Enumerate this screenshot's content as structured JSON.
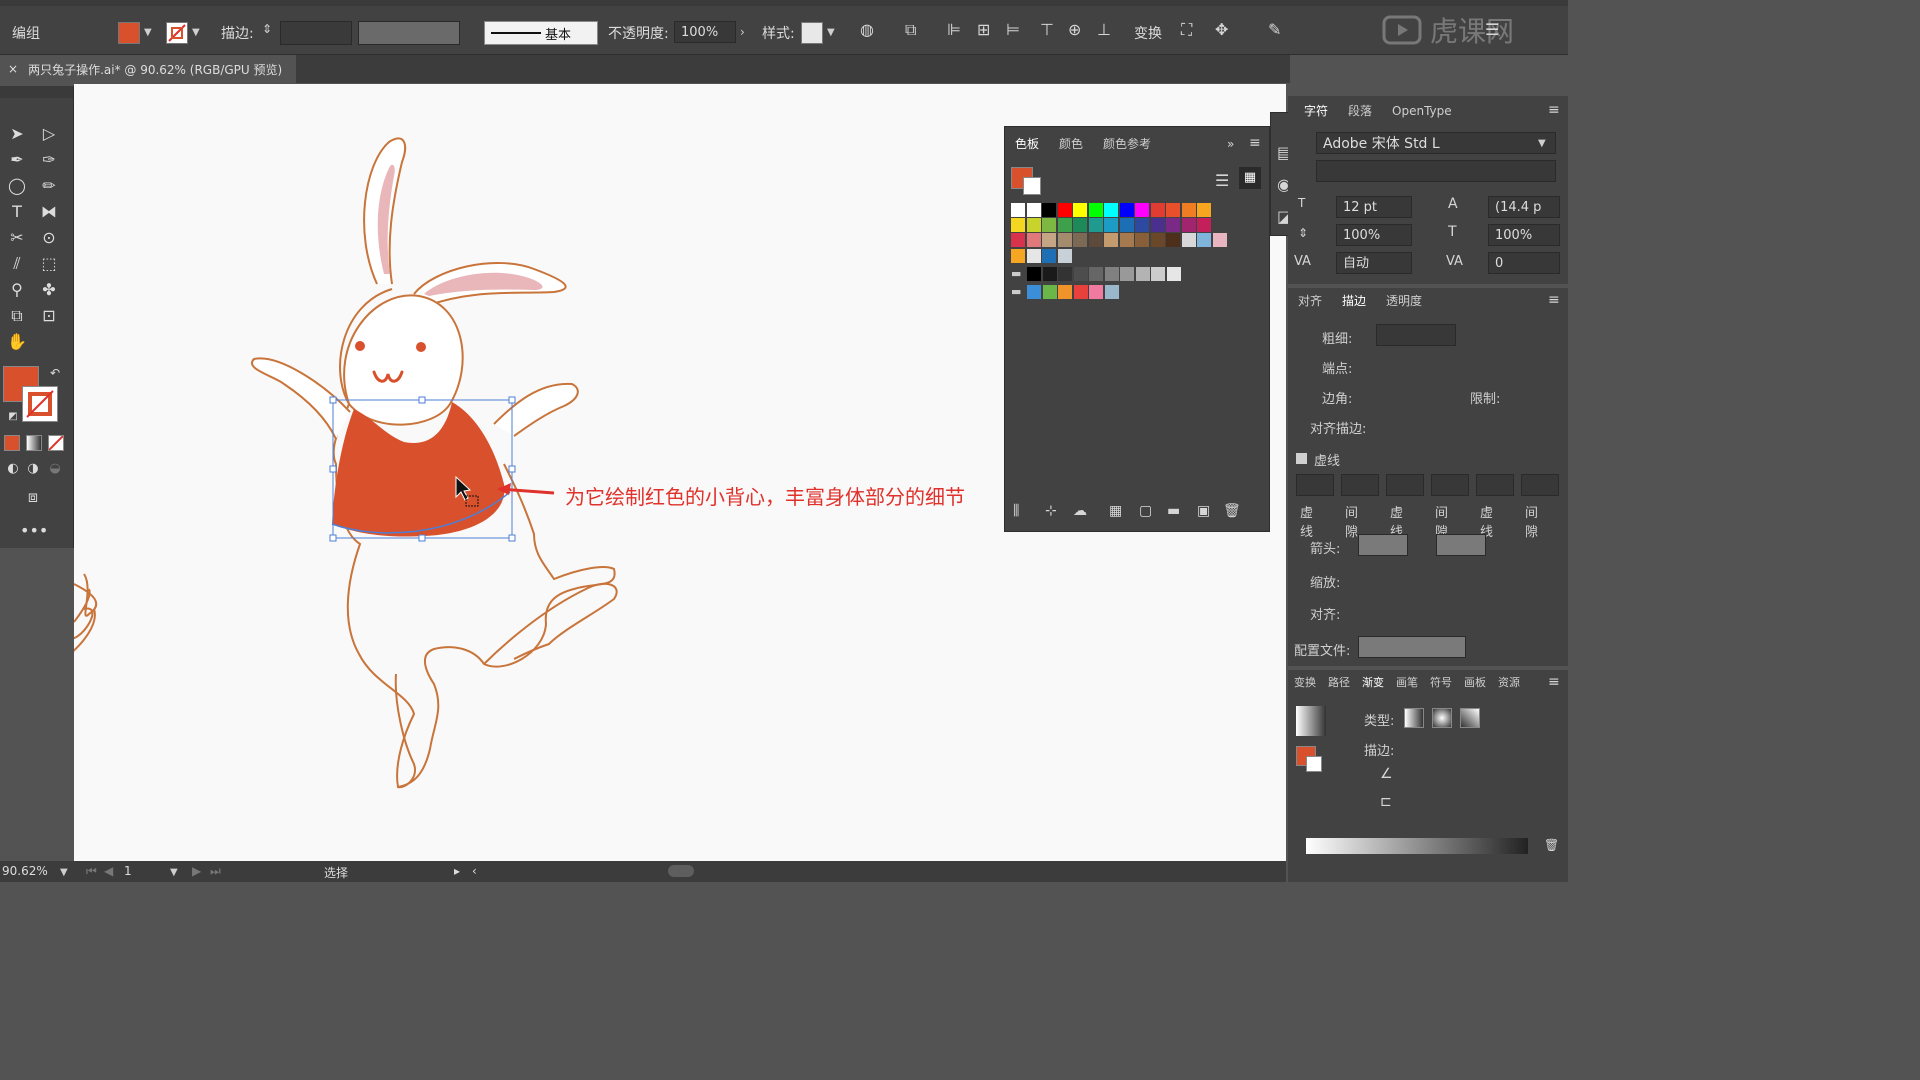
{
  "control_bar": {
    "group_label": "编组",
    "stroke_label": "描边:",
    "stroke_style_label": "基本",
    "opacity_label": "不透明度:",
    "opacity_value": "100%",
    "style_label": "样式:",
    "transform_label": "变换",
    "fill_color": "#d9512c"
  },
  "document_tab": {
    "close_glyph": "×",
    "title": "两只兔子操作.ai* @ 90.62% (RGB/GPU 预览)"
  },
  "canvas": {
    "annotation_text": "为它绘制红色的小背心，丰富身体部分的细节"
  },
  "swatches_panel": {
    "tabs": [
      "色板",
      "颜色",
      "颜色参考"
    ],
    "row1": [
      "#ffffff",
      "#ffffff",
      "#000000",
      "#ff0000",
      "#ffff00",
      "#00ff00",
      "#00ffff",
      "#0000ff",
      "#ff00ff",
      "#e03c31",
      "#e8502c",
      "#f07d22",
      "#f7a71f"
    ],
    "row2": [
      "#f5d722",
      "#c8d42c",
      "#7cb842",
      "#3ea04a",
      "#1e8a5a",
      "#1f9a8e",
      "#1c9bc4",
      "#1c6fb5",
      "#2d4aa0",
      "#4b2f8f",
      "#7a2a86",
      "#a1246f",
      "#c31f5a"
    ],
    "row3": [
      "#d8324d",
      "#e0787c",
      "#c4a584",
      "#a48b6e",
      "#7c6a55",
      "#5e4a3a",
      "#c39b6e",
      "#a47a4e",
      "#87603a",
      "#6b472a",
      "#4e2f1c",
      "#d8d8d8",
      "#7fb5dc",
      "#e8b4c0"
    ],
    "row4": [
      "#f5a623",
      "#e6e6e6",
      "#1f6fb5",
      "#c8d0d8"
    ],
    "gray_row": [
      "#000000",
      "#1a1a1a",
      "#333333",
      "#4d4d4d",
      "#666666",
      "#808080",
      "#999999",
      "#b3b3b3",
      "#cccccc",
      "#e6e6e6"
    ],
    "color_row": [
      "#3a8fd8",
      "#6ab648",
      "#f0932b",
      "#e8403a",
      "#f07aa0",
      "#9ab8cc"
    ]
  },
  "char_panel": {
    "tabs": [
      "字符",
      "段落",
      "OpenType"
    ],
    "font_name": "Adobe 宋体 Std L",
    "size": "12 pt",
    "leading": "(14.4 p",
    "v_scale": "100%",
    "h_scale": "100%",
    "kerning": "自动",
    "tracking": "0"
  },
  "stroke_panel": {
    "tabs": [
      "对齐",
      "描边",
      "透明度"
    ],
    "weight_label": "粗细:",
    "cap_label": "端点:",
    "corner_label": "边角:",
    "limit_label": "限制:",
    "align_label": "对齐描边:",
    "dashed_label": "虚线",
    "dash_labels": [
      "虚线",
      "间隙",
      "虚线",
      "间隙",
      "虚线",
      "间隙"
    ],
    "arrow_label": "箭头:",
    "scale_label": "缩放:",
    "align2_label": "对齐:",
    "profile_label": "配置文件:"
  },
  "gradient_panel": {
    "tabs": [
      "变换",
      "路径",
      "渐变",
      "画笔",
      "符号",
      "画板",
      "资源"
    ],
    "type_label": "类型:",
    "stroke_label": "描边:"
  },
  "status_bar": {
    "zoom": "90.62%",
    "page": "1",
    "mode": "选择"
  },
  "watermark": "虎课网",
  "colors": {
    "accent_red": "#d9512c",
    "rabbit_outline": "#c8743a",
    "ear_pink": "#e9b6ba",
    "annotation_red": "#e0312b",
    "selection_blue": "#4d7fd6"
  }
}
